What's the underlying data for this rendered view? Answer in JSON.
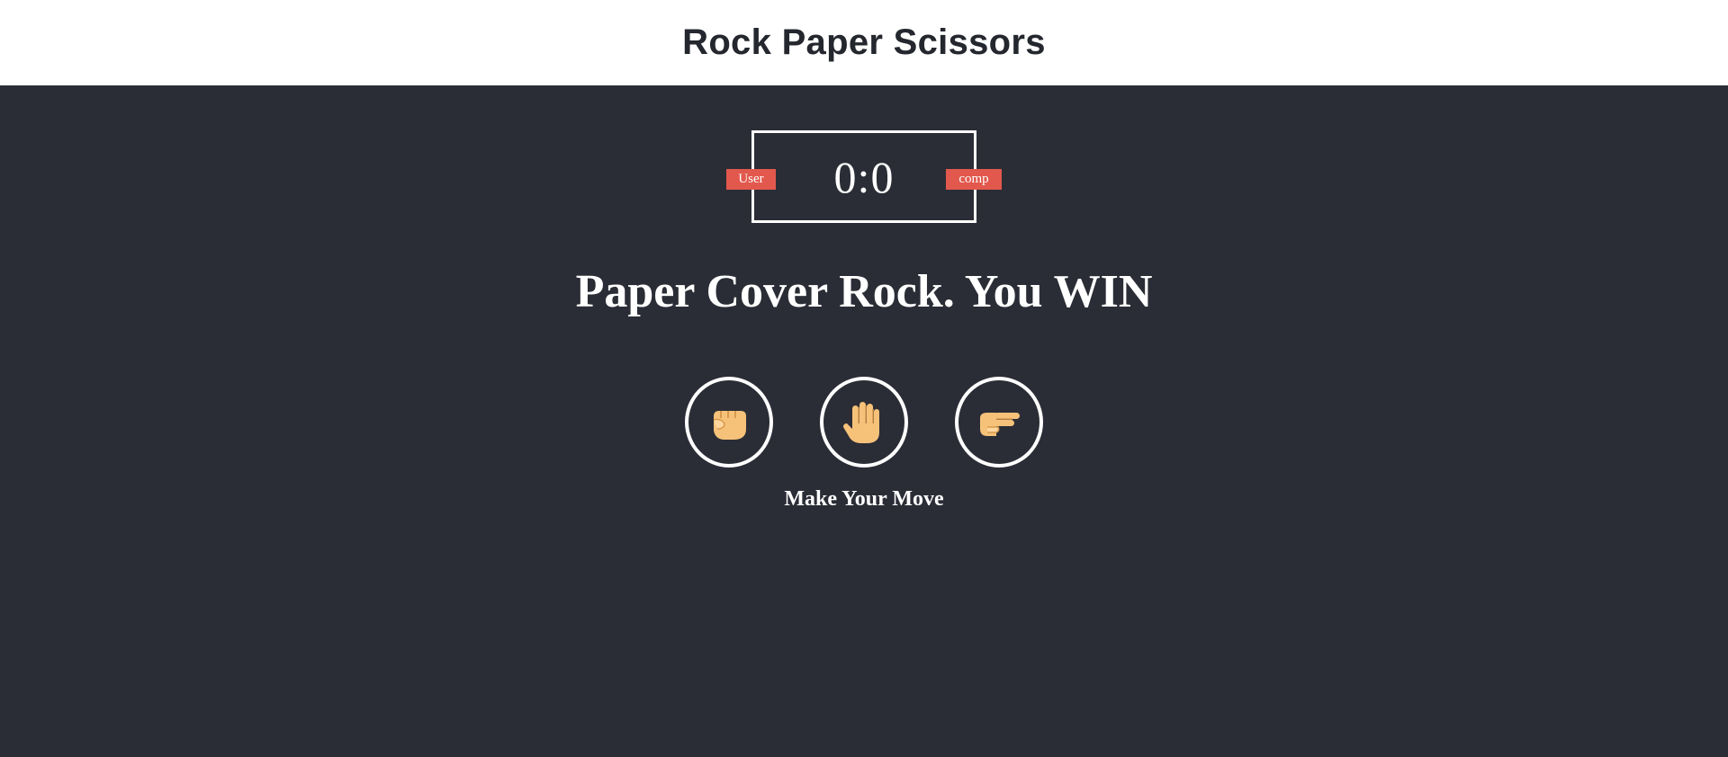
{
  "header": {
    "title": "Rock Paper Scissors"
  },
  "scoreboard": {
    "user_label": "User",
    "comp_label": "comp",
    "score": "0:0"
  },
  "result": {
    "text": "Paper Cover Rock. You WIN"
  },
  "choices": [
    {
      "id": "rock",
      "icon": "fist-icon"
    },
    {
      "id": "paper",
      "icon": "raised-hand-icon"
    },
    {
      "id": "scissors",
      "icon": "pointing-hand-icon"
    }
  ],
  "action_message": "Make Your Move",
  "colors": {
    "background": "#2b2d36",
    "header_bg": "#ffffff",
    "badge": "#e2584d",
    "skin": "#f6c27a"
  }
}
